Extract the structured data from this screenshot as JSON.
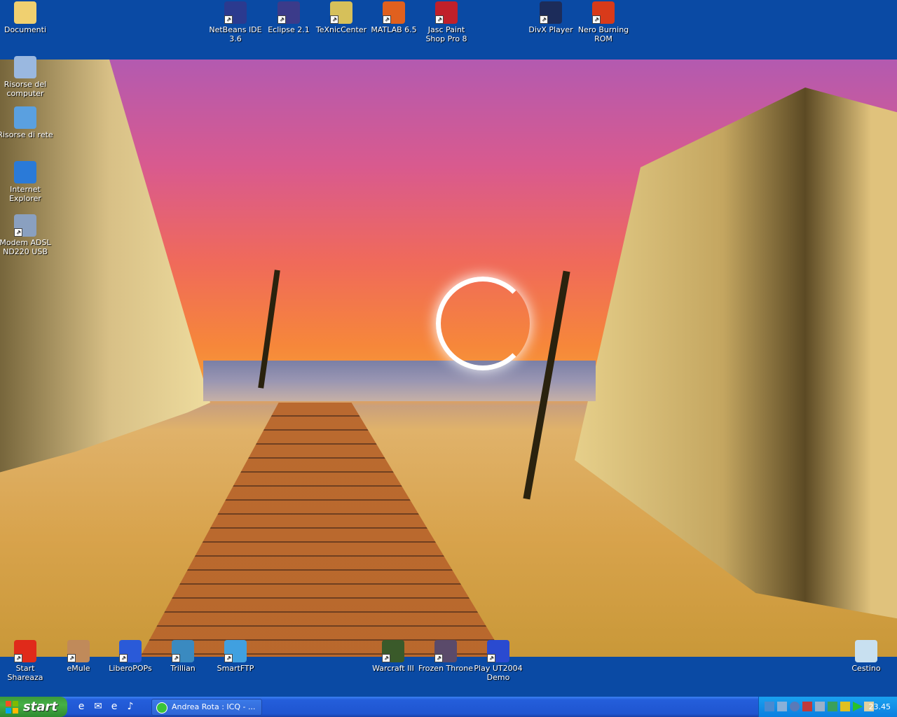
{
  "desktop": {
    "top_icons": [
      {
        "name": "netbeans-icon",
        "label": "NetBeans IDE 3.6",
        "color": "#2b3a8f"
      },
      {
        "name": "eclipse-icon",
        "label": "Eclipse 2.1",
        "color": "#3b3b8a"
      },
      {
        "name": "texniccenter-icon",
        "label": "TeXnicCenter",
        "color": "#d6c05a"
      },
      {
        "name": "matlab-icon",
        "label": "MATLAB 6.5",
        "color": "#e0601e"
      },
      {
        "name": "paintshop-icon",
        "label": "Jasc Paint Shop Pro 8",
        "color": "#c0202a"
      },
      {
        "name": "divx-player-icon",
        "label": "DivX Player",
        "color": "#1c2c5a"
      },
      {
        "name": "nero-icon",
        "label": "Nero Burning ROM",
        "color": "#d83a1a"
      }
    ],
    "left_icons": [
      {
        "name": "documenti-icon",
        "label": "Documenti",
        "color": "#f0d070"
      },
      {
        "name": "my-computer-icon",
        "label": "Risorse del computer",
        "color": "#9ab8e0"
      },
      {
        "name": "network-icon",
        "label": "Risorse di rete",
        "color": "#5aa0e0"
      },
      {
        "name": "internet-explorer-icon",
        "label": "Internet Explorer",
        "color": "#2a7ad8"
      },
      {
        "name": "modem-icon",
        "label": "Modem ADSL ND220 USB",
        "color": "#8aa0c0"
      }
    ],
    "bottom_icons": [
      {
        "name": "shareaza-icon",
        "label": "Start Shareaza",
        "color": "#e02a1a"
      },
      {
        "name": "emule-icon",
        "label": "eMule",
        "color": "#c08a5a"
      },
      {
        "name": "liberopops-icon",
        "label": "LiberoPOPs",
        "color": "#2a5ad8"
      },
      {
        "name": "trillian-icon",
        "label": "Trillian",
        "color": "#3a8ac0"
      },
      {
        "name": "smartftp-icon",
        "label": "SmartFTP",
        "color": "#40a0e0"
      },
      {
        "name": "warcraft-icon",
        "label": "Warcraft III",
        "color": "#3a5a2a"
      },
      {
        "name": "frozen-throne-icon",
        "label": "Frozen Throne",
        "color": "#5a4a6a"
      },
      {
        "name": "ut2004-icon",
        "label": "Play UT2004 Demo",
        "color": "#2a4ad0"
      },
      {
        "name": "recycle-bin-icon",
        "label": "Cestino",
        "color": "#c8e0f0"
      }
    ]
  },
  "taskbar": {
    "start_label": "start",
    "quick_launch": [
      "ie-quicklaunch-icon",
      "outlook-quicklaunch-icon",
      "ie2-quicklaunch-icon",
      "media-quicklaunch-icon"
    ],
    "tasks": [
      {
        "label": "Andrea Rota : ICQ - ..."
      }
    ],
    "clock": "23.45"
  },
  "colors": {
    "taskbar": "#245edb",
    "start": "#3c9a3c",
    "tray": "#0c7fe0"
  }
}
